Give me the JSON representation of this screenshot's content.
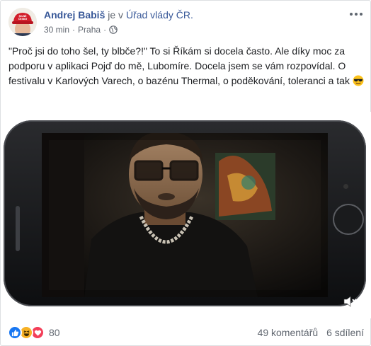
{
  "post": {
    "author": "Andrej Babiš",
    "location_prefix": "je v",
    "location": "Úřad vlády ČR.",
    "time": "30 min",
    "separator": "·",
    "place": "Praha",
    "separator2": "·",
    "text": "\"Proč jsi do toho šel, ty blbče?!\" To si Říkám si docela často. Ale díky moc za podporu v aplikaci Pojď do mě, Lubomíre. Docela jsem se vám rozpovídal. O festivalu v Karlových Varech, o bazénu Thermal, o poděkování, toleranci a tak",
    "avatar_cap_text": "SILNÉ ČESKO"
  },
  "footer": {
    "reactions_count": "80",
    "comments": "49 komentářů",
    "shares": "6 sdílení"
  },
  "colors": {
    "link": "#385898",
    "like": "#1877f2",
    "haha": "#f7b125",
    "love": "#f33e58"
  },
  "icons": {
    "privacy": "globe-icon",
    "more": "more-options-icon",
    "sound": "sound-icon",
    "emoji": "sunglasses-emoji"
  }
}
